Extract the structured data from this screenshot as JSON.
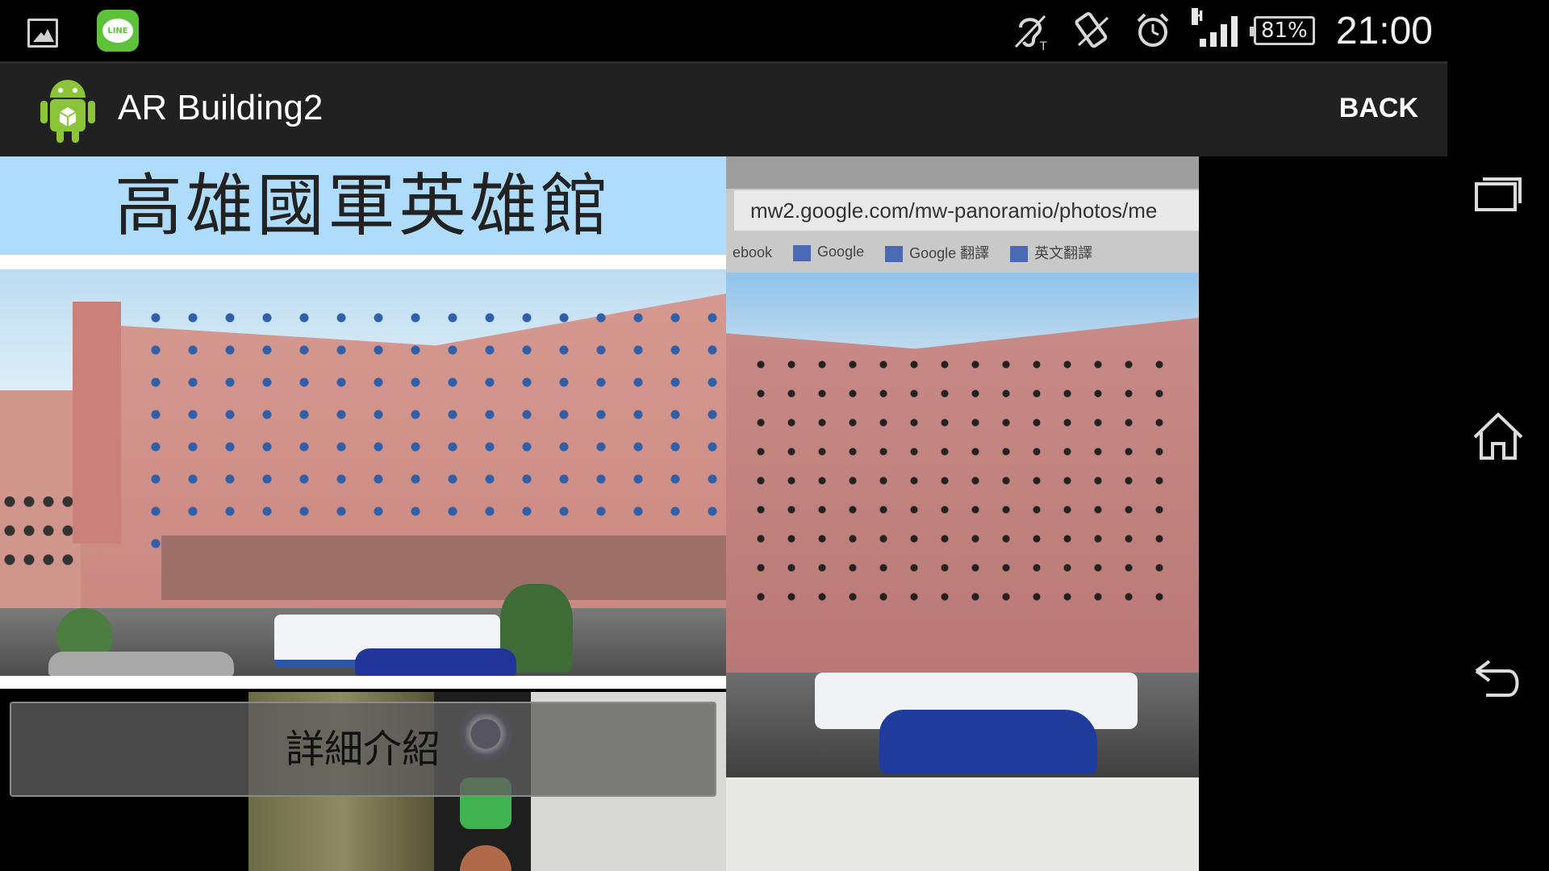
{
  "status_bar": {
    "time": "21:00",
    "battery": "81%",
    "network_type": "H",
    "left_icons": [
      "gallery-icon",
      "line-app-icon"
    ],
    "line_label": "LINE",
    "right_icons": [
      "hearing-aid-icon",
      "vibrate-icon",
      "alarm-icon",
      "signal-icon",
      "battery-icon"
    ]
  },
  "action_bar": {
    "title": "AR Building2",
    "back_label": "BACK",
    "app_icon": "android-robot-icon"
  },
  "info_card": {
    "building_name": "高雄國軍英雄館",
    "details_button": "詳細介紹"
  },
  "camera_feed": {
    "url_text": "mw2.google.com/mw-panoramio/photos/me",
    "bookmarks": [
      "ebook",
      "Google",
      "Google 翻譯",
      "英文翻譯"
    ]
  },
  "nav_bar": {
    "buttons": [
      "recent-apps-icon",
      "home-icon",
      "back-icon"
    ]
  },
  "colors": {
    "title_band": "#aedcfa",
    "action_bar": "#212121",
    "status_bar": "#000000"
  }
}
